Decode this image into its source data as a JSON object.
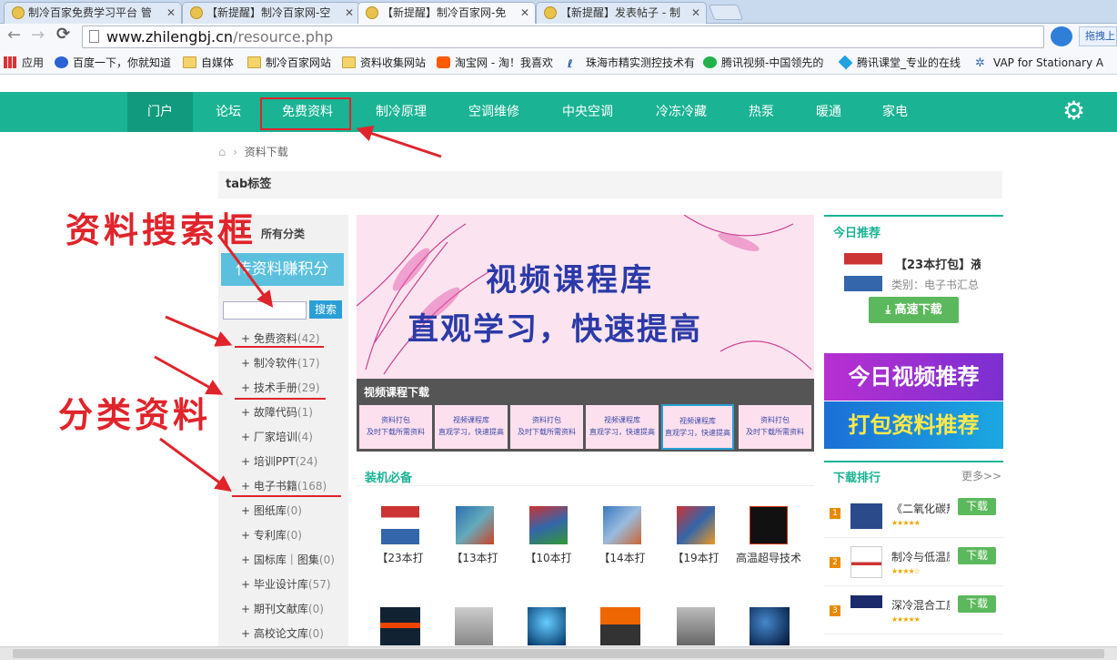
{
  "browser": {
    "tabs": [
      {
        "title": "制冷百家免费学习平台 管"
      },
      {
        "title": "【新提醒】制冷百家网-空"
      },
      {
        "title": "【新提醒】制冷百家网-免"
      },
      {
        "title": "【新提醒】发表帖子 - 制"
      }
    ],
    "url_domain": "www.zhilengbj.cn",
    "url_path": "/resource.php",
    "ext_button": "拖拽上",
    "bookmarks": [
      {
        "label": "应用"
      },
      {
        "label": "百度一下，你就知道"
      },
      {
        "label": "自媒体"
      },
      {
        "label": "制冷百家网站"
      },
      {
        "label": "资料收集网站"
      },
      {
        "label": "淘宝网 - 淘！我喜欢"
      },
      {
        "label": "珠海市精实测控技术有"
      },
      {
        "label": "腾讯视频-中国领先的"
      },
      {
        "label": "腾讯课堂_专业的在线"
      },
      {
        "label": "VAP for Stationary A"
      }
    ]
  },
  "nav": {
    "items": [
      "门户",
      "论坛",
      "免费资料",
      "制冷原理",
      "空调维修",
      "中央空调",
      "冷冻冷藏",
      "热泵",
      "暖通",
      "家电"
    ]
  },
  "breadcrumb": {
    "current": "资料下载"
  },
  "tab_title": "tab标签",
  "sidebar": {
    "all_categories": "所有分类",
    "upload_banner": "传资料赚积分",
    "search_button": "搜索",
    "search_value": "",
    "categories": [
      {
        "name": "免费资料",
        "count": "(42)"
      },
      {
        "name": "制冷软件",
        "count": "(17)"
      },
      {
        "name": "技术手册",
        "count": "(29)"
      },
      {
        "name": "故障代码",
        "count": "(1)"
      },
      {
        "name": "厂家培训",
        "count": "(4)"
      },
      {
        "name": "培训PPT",
        "count": "(24)"
      },
      {
        "name": "电子书籍",
        "count": "(168)"
      },
      {
        "name": "图纸库",
        "count": "(0)"
      },
      {
        "name": "专利库",
        "count": "(0)"
      },
      {
        "name": "国标库｜图集",
        "count": "(0)"
      },
      {
        "name": "毕业设计库",
        "count": "(57)"
      },
      {
        "name": "期刊文献库",
        "count": "(0)"
      },
      {
        "name": "高校论文库",
        "count": "(0)"
      }
    ]
  },
  "banner": {
    "line1": "视频课程库",
    "line2": "直观学习，快速提高",
    "strip_title": "视频课程下载",
    "thumb_a": "资料打包\n及时下载所需资料",
    "thumb_b": "视频课程库\n直观学习，快速提高"
  },
  "install": {
    "title": "装机必备",
    "books": [
      "【23本打",
      "【13本打",
      "【10本打",
      "【14本打",
      "【19本打",
      "高温超导技术"
    ]
  },
  "right": {
    "today_title": "今日推荐",
    "today_item": "【23本打包】液",
    "today_category": "类别：电子书汇总",
    "fast_download": "高速下载",
    "video_promo": "今日视频推荐",
    "pack_promo": "打包资料推荐",
    "ranking_title": "下载排行",
    "more": "更多>>",
    "ranking": [
      {
        "rank": "1",
        "title": "《二氧化碳热",
        "button": "下载"
      },
      {
        "rank": "2",
        "title": "制冷与低温原",
        "button": "下载"
      },
      {
        "rank": "3",
        "title": "深冷混合工质",
        "button": "下载"
      }
    ]
  },
  "annotations": {
    "search_box": "资料搜索框",
    "categories": "分类资料"
  },
  "colors": {
    "nav_green": "#1ab394",
    "annotation_red": "#e0242b",
    "download_green": "#5cb85c"
  }
}
